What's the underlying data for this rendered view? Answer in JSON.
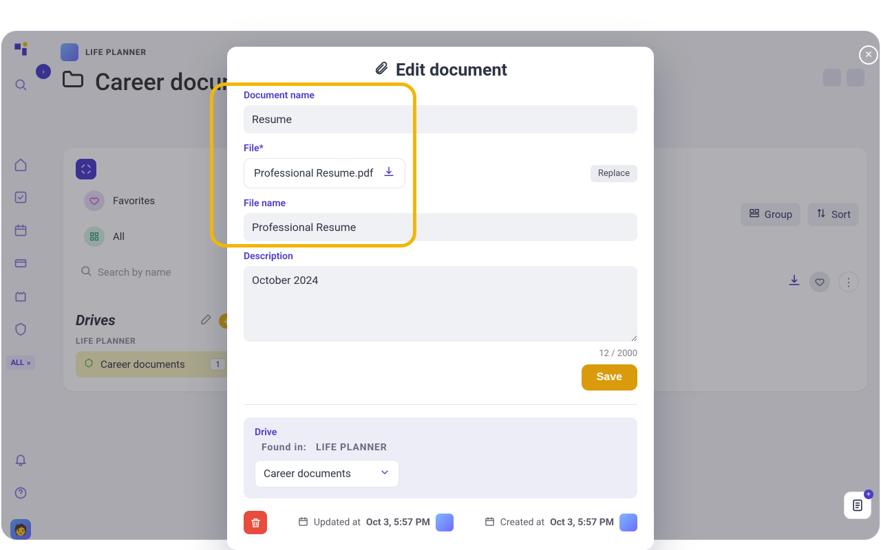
{
  "workspace": {
    "name": "LIFE PLANNER"
  },
  "page": {
    "title": "Career documents"
  },
  "sidebar": {
    "all_label": "ALL"
  },
  "tray": {
    "favorites_label": "Favorites",
    "all_label": "All",
    "search_placeholder": "Search by name",
    "drives_heading": "Drives",
    "drive_sub": "LIFE PLANNER",
    "drive_item": {
      "name": "Career documents",
      "count": "1"
    }
  },
  "controls": {
    "group": "Group",
    "sort": "Sort"
  },
  "modal": {
    "title": "Edit document",
    "labels": {
      "doc_name": "Document name",
      "file": "File*",
      "file_name": "File name",
      "description": "Description",
      "drive": "Drive",
      "found_in": "Found in:",
      "updated_at": "Updated at",
      "created_at": "Created at"
    },
    "values": {
      "doc_name": "Resume",
      "file": "Professional Resume.pdf",
      "file_name": "Professional Resume",
      "description": "October 2024",
      "drive_select": "Career documents",
      "found_in_value": "LIFE PLANNER",
      "updated_at": "Oct 3, 5:57 PM",
      "created_at": "Oct 3, 5:57 PM"
    },
    "replace_label": "Replace",
    "save_label": "Save",
    "char_count": "12 / 2000"
  }
}
